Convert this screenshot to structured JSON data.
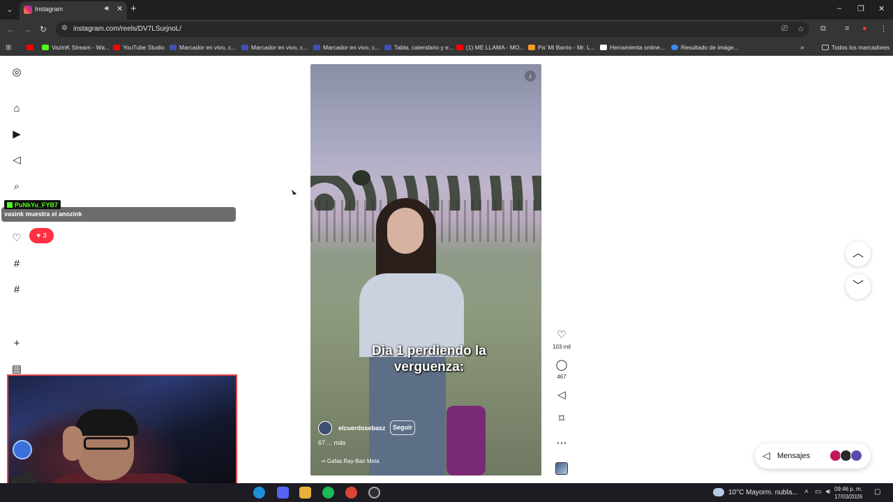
{
  "browser": {
    "tab_title": "Instagram",
    "url": "instagram.com/reels/DV7LSurjnoL/",
    "window_controls": [
      "–",
      "❐",
      "✕"
    ],
    "bookmarks": [
      {
        "label": "VazinK Stream - Wa...",
        "color": "#53fc18"
      },
      {
        "label": "YouTube Studio",
        "color": "#ff0000"
      },
      {
        "label": "Marcador en vivo, c...",
        "color": "#3f51b5"
      },
      {
        "label": "Marcador en vivo, c...",
        "color": "#3f51b5"
      },
      {
        "label": "Marcador en vivo, c...",
        "color": "#3f51b5"
      },
      {
        "label": "Tabla, calendario y e...",
        "color": "#3f51b5"
      },
      {
        "label": "(1) ME LLAMA - MO...",
        "color": "#ff0000"
      },
      {
        "label": "Pa' Mi Barrio - Mr. L...",
        "color": "#f59a23"
      },
      {
        "label": "Herramienta online...",
        "color": "#ffffff"
      },
      {
        "label": "Resultado de imáge...",
        "color": "#4285f4"
      }
    ],
    "all_bookmarks": "Todos los marcadores"
  },
  "chat_overlay": {
    "username": "PuNkYu_FYB7",
    "message": "vasink muestra el anozink"
  },
  "notifications": {
    "count": "3"
  },
  "reel": {
    "caption": "Dia 1 perdiendo la verguenza:",
    "username": "elcuerdosebasz",
    "follow_label": "Seguir",
    "description_count": "67",
    "description_more": "... más",
    "tag": "∞ Gafas Ray-Ban Meta",
    "likes": "103 mil",
    "comments": "467"
  },
  "messages": {
    "label": "Mensajes"
  },
  "taskbar": {
    "weather": "10°C  Mayorm. nubla...",
    "time": "09:46 p. m.",
    "date": "17/03/2026"
  }
}
